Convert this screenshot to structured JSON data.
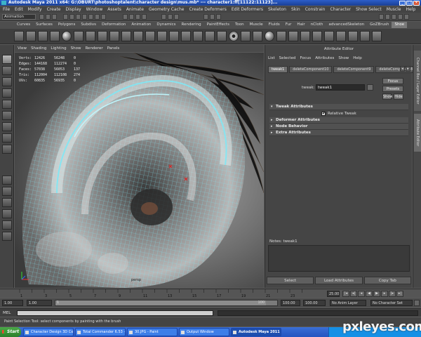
{
  "window": {
    "title": "Autodesk Maya 2011 x64: G:\\OBURT\\photoshoptalent\\character design\\mus.mb*  ---  character1:ff[11122:11123]..."
  },
  "menubar": [
    "File",
    "Edit",
    "Modify",
    "Create",
    "Display",
    "Window",
    "Assets",
    "Animate",
    "Geometry Cache",
    "Create Deformers",
    "Edit Deformers",
    "Skeleton",
    "Skin",
    "Constrain",
    "Character",
    "Show Select",
    "Muscle",
    "Help"
  ],
  "statusline": {
    "mode": "Animation"
  },
  "shelf": {
    "tabs": [
      "Curves",
      "Surfaces",
      "Polygons",
      "Subdivs",
      "Deformation",
      "Animation",
      "Dynamics",
      "Rendering",
      "PaintEffects",
      "Toon",
      "Muscle",
      "Fluids",
      "Fur",
      "Hair",
      "nCloth",
      "advancedSkeleton",
      "GoZBrush",
      "Shoe"
    ],
    "active_tab": "Shoe"
  },
  "viewport": {
    "menu": [
      "View",
      "Shading",
      "Lighting",
      "Show",
      "Renderer",
      "Panels"
    ],
    "hud": [
      {
        "label": "Verts:",
        "a": "12426",
        "b": "56248",
        "c": "0"
      },
      {
        "label": "Edges:",
        "a": "144168",
        "b": "112274",
        "c": "0"
      },
      {
        "label": "Faces:",
        "a": "57038",
        "b": "56053",
        "c": "137"
      },
      {
        "label": "Tris:",
        "a": "112004",
        "b": "112108",
        "c": "274"
      },
      {
        "label": "UVs:",
        "a": "60835",
        "b": "56935",
        "c": "0"
      }
    ],
    "camera": "persp"
  },
  "attribute_editor": {
    "title": "Attribute Editor",
    "menu": [
      "List",
      "Selected",
      "Focus",
      "Attributes",
      "Show",
      "Help"
    ],
    "tabs": [
      "tweak1",
      "deleteComponent10",
      "deleteComponent9",
      "deleteComponent8"
    ],
    "node_label": "tweak:",
    "node_value": "tweak1",
    "buttons": {
      "focus": "Focus",
      "presets": "Presets",
      "show": "Show",
      "hide": "Hide"
    },
    "sections": {
      "tweak": "Tweak Attributes",
      "relative": "Relative Tweak",
      "deformer": "Deformer Attributes",
      "node_behavior": "Node Behavior",
      "extra": "Extra Attributes"
    },
    "notes_label": "Notes: tweak1",
    "bottom_buttons": [
      "Select",
      "Load Attributes",
      "Copy Tab"
    ]
  },
  "side_tabs": [
    "Channel Box / Layer Editor",
    "Attribute Editor"
  ],
  "timeslider": {
    "ticks": [
      "1",
      "2",
      "3",
      "4",
      "5",
      "6",
      "7",
      "8",
      "9",
      "10",
      "11",
      "12",
      "13",
      "14",
      "15",
      "16",
      "17",
      "18",
      "19",
      "20",
      "21",
      "22",
      "23",
      "24"
    ],
    "current_frame": "25.00"
  },
  "rangeslider": {
    "start": "1.00",
    "start2": "1.00",
    "inner_start": "1",
    "inner_end": "100",
    "end": "100.00",
    "end2": "100.00",
    "anim_layer": "No Anim Layer",
    "character_set": "No Character Set"
  },
  "cmdline": {
    "label": "MEL"
  },
  "helpline": {
    "text": "Paint Selection Tool: select components by painting with the brush"
  },
  "taskbar": {
    "start": "Start",
    "tasks": [
      "Character Design 3D Co...",
      "Total Commander 6.53 -...",
      "30.JPG - Paint",
      "Output Window",
      "Autodesk Maya 2011 ..."
    ],
    "active_task": "Autodesk Maya 2011 ..."
  },
  "watermark": "pxleyes.com"
}
